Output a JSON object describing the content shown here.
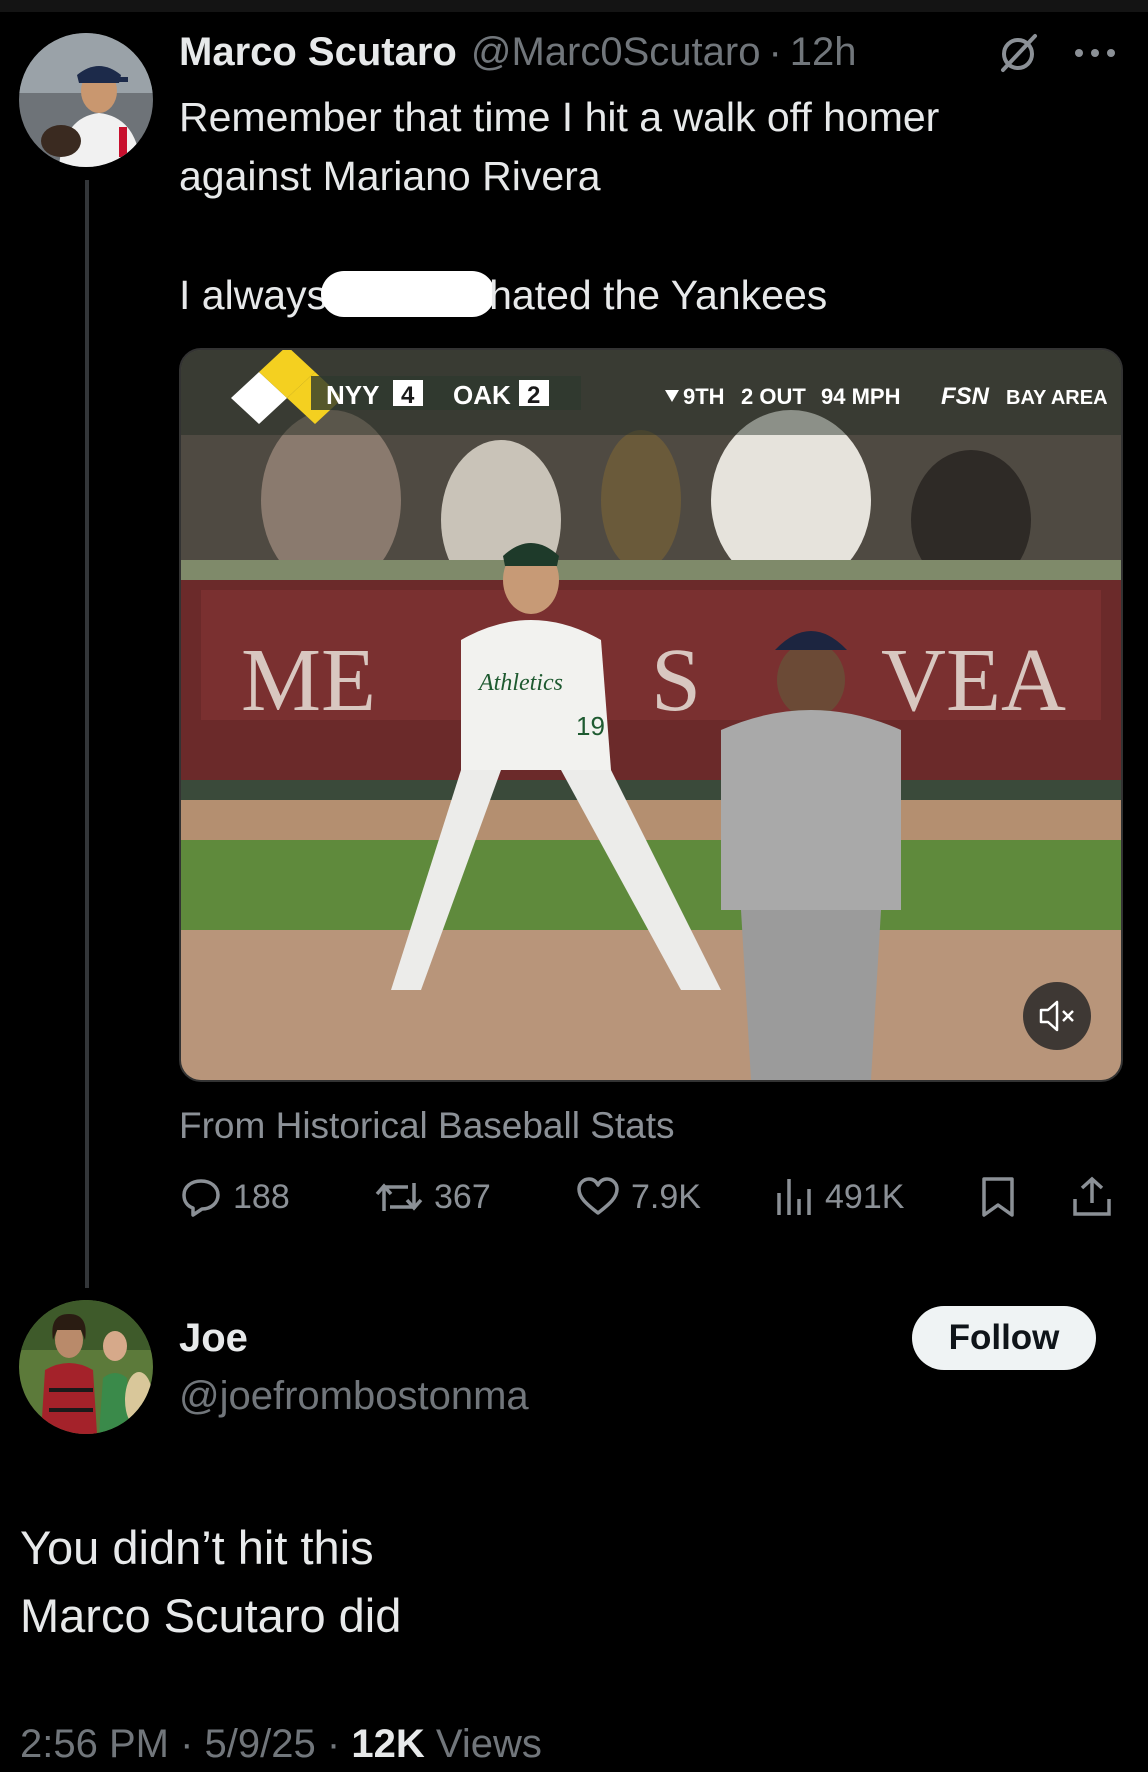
{
  "tweet": {
    "author_name": "Marco Scutaro",
    "author_handle": "@Marc0Scutaro",
    "separator": "·",
    "time": "12h",
    "text_line1": "Remember that time I hit a walk off homer",
    "text_line2": "against Mariano Rivera",
    "text_line3_before": "I always",
    "text_line3_after": "hated the Yankees",
    "video": {
      "scoreboard_team1": "NYY",
      "scoreboard_score1": "4",
      "scoreboard_team2": "OAK",
      "scoreboard_score2": "2",
      "inning": "9TH",
      "outs": "2 OUT",
      "pitch_speed": "94 MPH",
      "network": "FSN",
      "network_region": "BAY AREA",
      "wall_text_left": "ME",
      "wall_text_mid": "S",
      "wall_text_right": "VEA",
      "jersey_script": "Athletics",
      "jersey_number": "19"
    },
    "source": "From Historical Baseball Stats",
    "stats": {
      "replies": "188",
      "reposts": "367",
      "likes": "7.9K",
      "views": "491K"
    }
  },
  "reply": {
    "author_name": "Joe",
    "author_handle": "@joefrombostonma",
    "follow_label": "Follow",
    "text_line1": "You didn’t hit this",
    "text_line2": "Marco Scutaro did",
    "meta_time": "2:56 PM",
    "meta_date": "5/9/25",
    "meta_views_count": "12K",
    "meta_views_label": "Views",
    "separator": "·"
  },
  "icons": [
    "grok-slash-icon",
    "more-icon",
    "reply-icon",
    "repost-icon",
    "like-icon",
    "views-icon",
    "bookmark-icon",
    "share-icon",
    "mute-icon"
  ],
  "colors": {
    "background": "#000000",
    "text": "#e7e9ea",
    "secondary": "#71767b",
    "follow_bg": "#eff3f4"
  }
}
